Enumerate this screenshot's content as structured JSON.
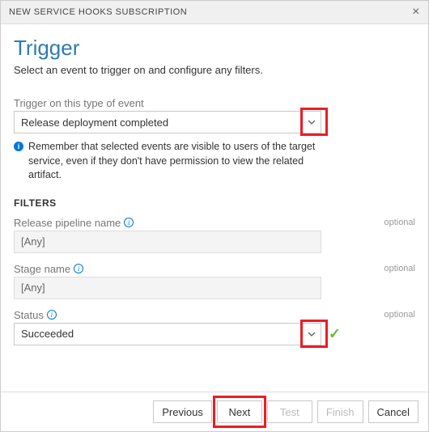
{
  "header": {
    "title": "NEW SERVICE HOOKS SUBSCRIPTION"
  },
  "page": {
    "title": "Trigger",
    "subtitle": "Select an event to trigger on and configure any filters."
  },
  "event": {
    "label": "Trigger on this type of event",
    "selected": "Release deployment completed",
    "note": "Remember that selected events are visible to users of the target service, even if they don't have permission to view the related artifact."
  },
  "filters": {
    "heading": "FILTERS",
    "optional_text": "optional",
    "pipeline": {
      "label": "Release pipeline name",
      "value": "[Any]"
    },
    "stage": {
      "label": "Stage name",
      "value": "[Any]"
    },
    "status": {
      "label": "Status",
      "value": "Succeeded"
    }
  },
  "footer": {
    "previous": "Previous",
    "next": "Next",
    "test": "Test",
    "finish": "Finish",
    "cancel": "Cancel"
  }
}
